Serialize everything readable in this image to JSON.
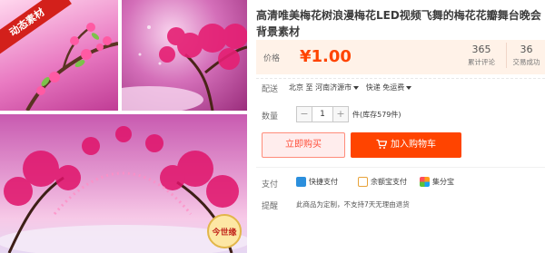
{
  "product": {
    "title": "高清唯美梅花树浪漫梅花LED视频飞舞的梅花花瓣舞台晚会背景素材"
  },
  "gallery": {
    "ribbon_text": "动态素材",
    "stamp_text": "今世缘"
  },
  "price": {
    "label": "价格",
    "value": "¥1.00"
  },
  "stats": {
    "reviews_count": "365",
    "reviews_label": "累计评论",
    "sales_count": "36",
    "sales_label": "交易成功"
  },
  "shipping": {
    "label": "配送",
    "text": "北京 至 河南济源市",
    "method": "快递 免运费"
  },
  "quantity": {
    "label": "数量",
    "minus": "−",
    "value": "1",
    "plus": "+",
    "stock": "件(库存579件)"
  },
  "actions": {
    "buy_now": "立即购买",
    "add_to_cart": "加入购物车"
  },
  "payment": {
    "label": "支付",
    "methods": [
      "快捷支付",
      "余额宝支付",
      "集分宝"
    ]
  },
  "notice": {
    "label": "提醒",
    "text": "此商品为定制，不支持7天无理由退货"
  },
  "colors": {
    "accent": "#ff4400",
    "price_bg": "#fff2e8",
    "buy_border": "#ff8c7a"
  }
}
